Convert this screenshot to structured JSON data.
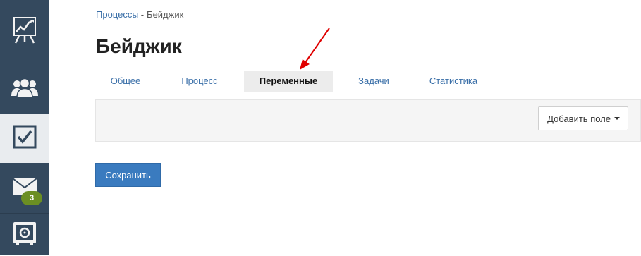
{
  "sidebar": {
    "items": [
      {
        "icon": "chart-presentation-icon"
      },
      {
        "icon": "users-group-icon"
      },
      {
        "icon": "checkbox-icon",
        "active": true
      },
      {
        "icon": "mail-icon",
        "badge": "3"
      },
      {
        "icon": "safe-icon"
      }
    ]
  },
  "breadcrumb": {
    "parent": "Процессы",
    "separator": "-",
    "current": "Бейджик"
  },
  "page": {
    "title": "Бейджик"
  },
  "tabs": [
    {
      "label": "Общее"
    },
    {
      "label": "Процесс"
    },
    {
      "label": "Переменные",
      "active": true
    },
    {
      "label": "Задачи"
    },
    {
      "label": "Статистика"
    }
  ],
  "toolbar": {
    "add_field_label": "Добавить поле"
  },
  "actions": {
    "save_label": "Сохранить"
  },
  "colors": {
    "sidebar": "#34495e",
    "accent": "#3a7bbf",
    "badge": "#6b8e23",
    "annotation": "#e00000"
  }
}
